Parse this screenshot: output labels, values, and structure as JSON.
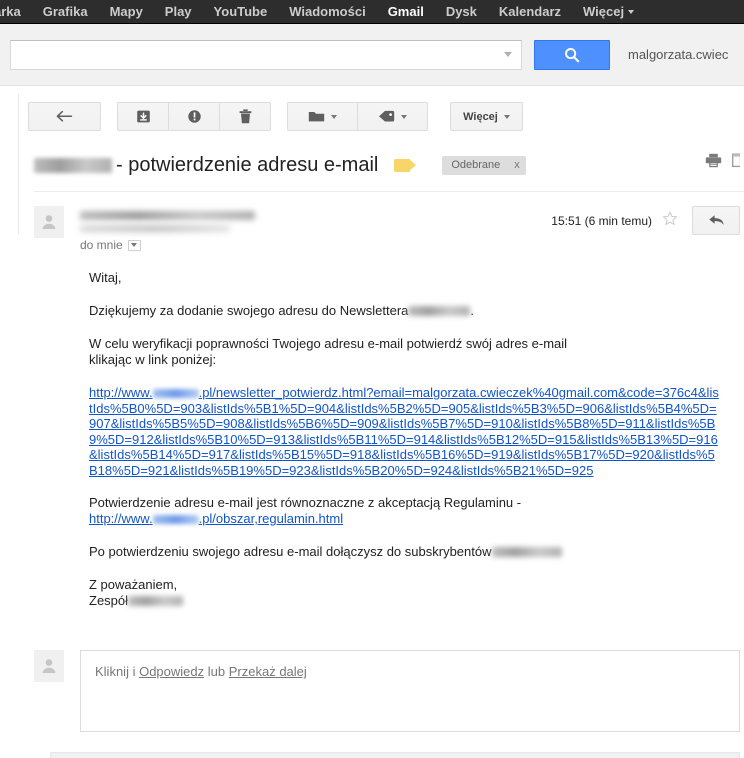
{
  "gnav": {
    "items": [
      {
        "label": "arka",
        "active": false
      },
      {
        "label": "Grafika",
        "active": false
      },
      {
        "label": "Mapy",
        "active": false
      },
      {
        "label": "Play",
        "active": false
      },
      {
        "label": "YouTube",
        "active": false
      },
      {
        "label": "Wiadomości",
        "active": false
      },
      {
        "label": "Gmail",
        "active": true
      },
      {
        "label": "Dysk",
        "active": false
      },
      {
        "label": "Kalendarz",
        "active": false
      },
      {
        "label": "Więcej",
        "active": false
      }
    ]
  },
  "header": {
    "search_value": "",
    "search_placeholder": "",
    "search_button_icon": "search-icon",
    "account_email": "malgorzata.cwiec"
  },
  "toolbar": {
    "back_icon": "back-arrow-icon",
    "archive_icon": "archive-icon",
    "spam_icon": "report-spam-icon",
    "delete_icon": "trash-icon",
    "move_icon": "folder-icon",
    "labels_icon": "label-tag-icon",
    "more_label": "Więcej"
  },
  "subject": {
    "redacted_sender": "",
    "text": "- potwierdzenie adresu e-mail",
    "label_icon": "yellow-label-icon",
    "chip_label": "Odebrane",
    "chip_close": "x",
    "print_icon": "printer-icon",
    "popout_icon": "open-in-new-window-icon"
  },
  "message": {
    "avatar_icon": "person-avatar-icon",
    "to_label": "do mnie",
    "timestamp": "15:51 (6 min temu)",
    "star_icon": "star-outline-icon",
    "reply_icon": "reply-arrow-icon"
  },
  "body": {
    "greeting": "Witaj,",
    "para_thanks_pre": "Dziękujemy za dodanie swojego adresu do Newslettera",
    "para_thanks_post": ".",
    "para_verify_l1": "W celu weryfikacji poprawności Twojego adresu e-mail potwierdź swój adres e-mail",
    "para_verify_l2": "klikając w link poniżej:",
    "confirm_url_pre": "http://www.",
    "confirm_url_post": ".pl/newsletter_potwierdz.html?email=malgorzata.cwieczek%40gmail.com&code=376c4&listIds%5B0%5D=903&listIds%5B1%5D=904&listIds%5B2%5D=905&listIds%5B3%5D=906&listIds%5B4%5D=907&listIds%5B5%5D=908&listIds%5B6%5D=909&listIds%5B7%5D=910&listIds%5B8%5D=911&listIds%5B9%5D=912&listIds%5B10%5D=913&listIds%5B11%5D=914&listIds%5B12%5D=915&listIds%5B13%5D=916&listIds%5B14%5D=917&listIds%5B15%5D=918&listIds%5B16%5D=919&listIds%5B17%5D=920&listIds%5B18%5D=921&listIds%5B19%5D=923&listIds%5B20%5D=924&listIds%5B21%5D=925",
    "para_terms": "Potwierdzenie adresu e-mail jest równoznaczne z akceptacją Regulaminu -",
    "terms_url_pre": "http://www.",
    "terms_url_post": ".pl/obszar,regulamin.html",
    "para_subscribe": "Po potwierdzeniu swojego adresu e-mail dołączysz do subskrybentów",
    "signoff_l1": "Z poważaniem,",
    "signoff_l2": "Zespół"
  },
  "reply": {
    "prefix": "Kliknij i",
    "reply_link": "Odpowiedz",
    "middle": "lub",
    "forward_link": "Przekaż dalej"
  },
  "colors": {
    "nav_bg": "#2d2d2d",
    "search_button": "#4d90fe",
    "link": "#1155cc",
    "label_yellow": "#f8d568",
    "chip_bg": "#dddddd"
  }
}
